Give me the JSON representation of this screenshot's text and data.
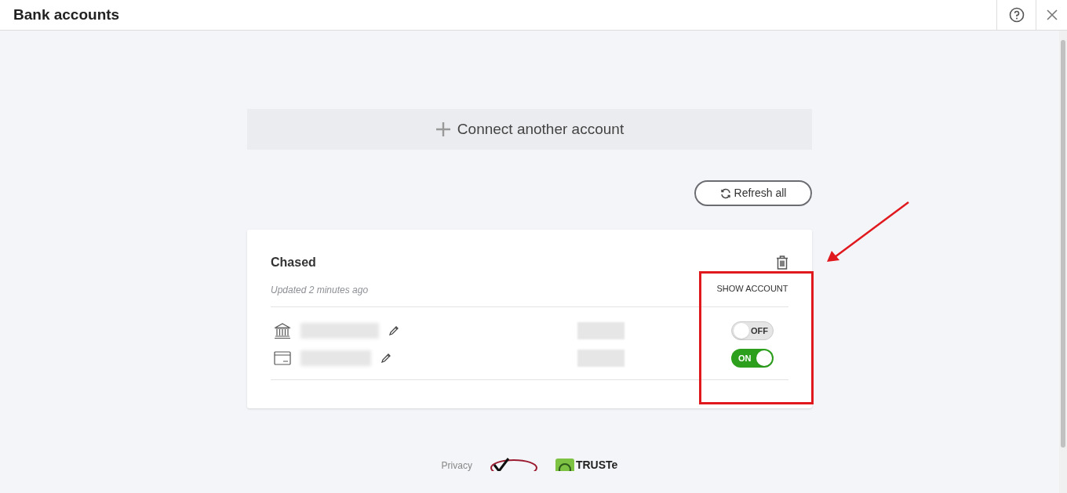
{
  "window": {
    "title": "Bank accounts"
  },
  "connect_button": {
    "label": "Connect another account"
  },
  "refresh_button": {
    "label": "Refresh all"
  },
  "bank": {
    "name": "Chased",
    "updated": "Updated 2 minutes ago",
    "column_header": "SHOW ACCOUNT",
    "accounts": [
      {
        "kind": "bank",
        "on": false,
        "toggle_label": "OFF"
      },
      {
        "kind": "card",
        "on": true,
        "toggle_label": "ON"
      }
    ]
  },
  "footer": {
    "privacy": "Privacy",
    "seal": "TRUSTe"
  }
}
